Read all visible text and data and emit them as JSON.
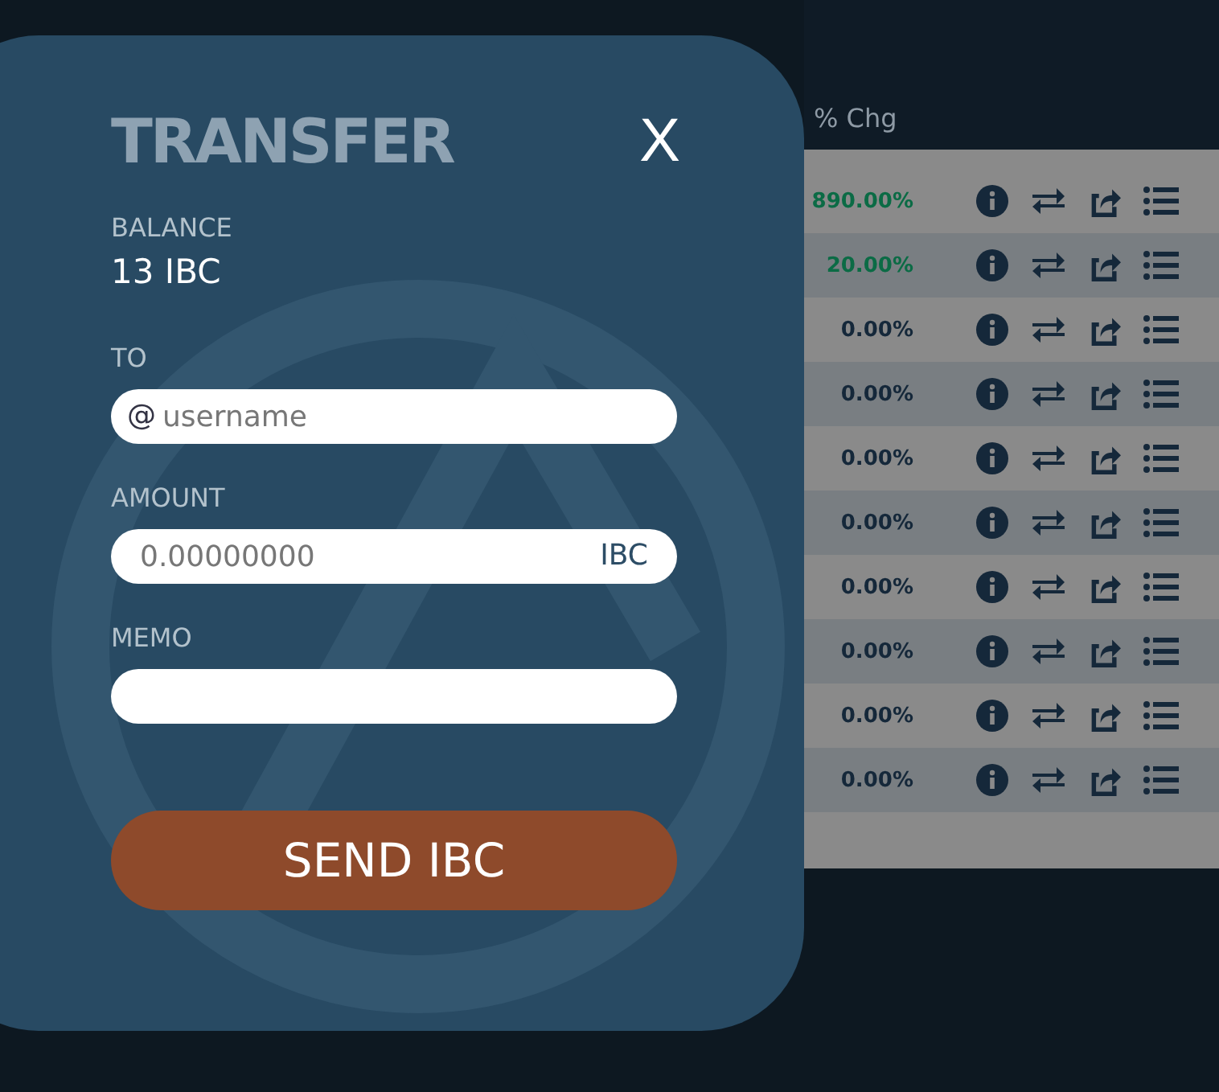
{
  "table": {
    "column_header": "% Chg",
    "rows": [
      {
        "change": "890.00%",
        "color": "#0b6b45"
      },
      {
        "change": "20.00%",
        "color": "#0b6b45"
      },
      {
        "change": "0.00%",
        "color": "#15283a"
      },
      {
        "change": "0.00%",
        "color": "#15283a"
      },
      {
        "change": "0.00%",
        "color": "#15283a"
      },
      {
        "change": "0.00%",
        "color": "#15283a"
      },
      {
        "change": "0.00%",
        "color": "#15283a"
      },
      {
        "change": "0.00%",
        "color": "#15283a"
      },
      {
        "change": "0.00%",
        "color": "#15283a"
      },
      {
        "change": "0.00%",
        "color": "#15283a"
      }
    ]
  },
  "dialog": {
    "title": "TRANSFER",
    "close": "X",
    "balance_label": "BALANCE",
    "balance": "13 IBC",
    "to_label": "TO",
    "to_prefix": "@",
    "to_placeholder": "username",
    "amount_label": "AMOUNT",
    "amount_placeholder": "0.00000000",
    "amount_unit": "IBC",
    "memo_label": "MEMO",
    "send_button": "SEND IBC"
  }
}
